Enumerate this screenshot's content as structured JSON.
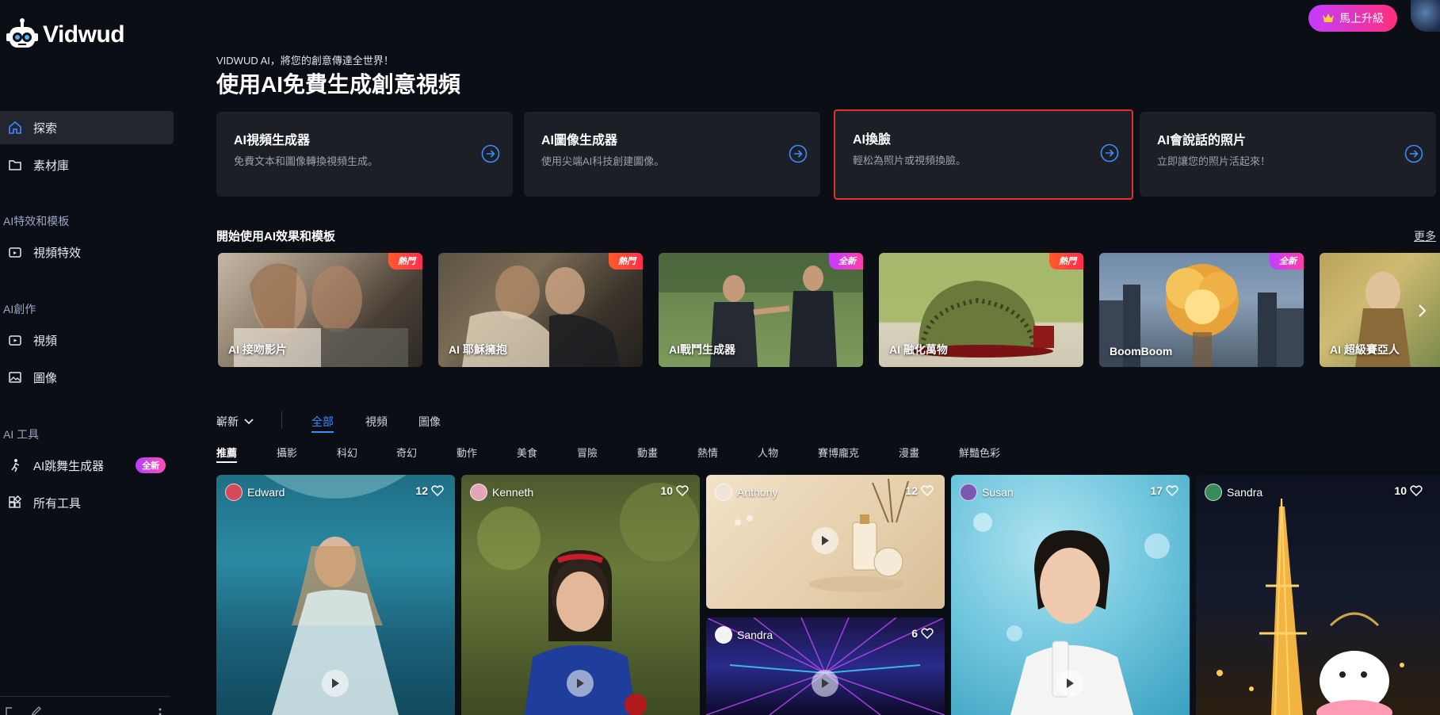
{
  "app": {
    "name": "Vidwud"
  },
  "sidebar": {
    "nav": [
      {
        "label": "探索",
        "icon": "home-icon"
      },
      {
        "label": "素材庫",
        "icon": "folder-icon"
      }
    ],
    "sections": [
      {
        "title": "AI特效和模板",
        "items": [
          {
            "label": "視頻特效",
            "icon": "video-effect-icon"
          }
        ]
      },
      {
        "title": "AI創作",
        "items": [
          {
            "label": "視頻",
            "icon": "video-icon"
          },
          {
            "label": "圖像",
            "icon": "image-icon"
          }
        ]
      },
      {
        "title": "AI 工具",
        "items": [
          {
            "label": "AI跳舞生成器",
            "icon": "dance-icon",
            "badge": "全新"
          },
          {
            "label": "所有工具",
            "icon": "grid-icon"
          }
        ]
      }
    ]
  },
  "topbar": {
    "upgrade_label": "馬上升級"
  },
  "header": {
    "tagline": "VIDWUD AI，將您的創意傳達全世界！",
    "title": "使用AI免費生成創意視頻"
  },
  "tools": [
    {
      "title": "AI視頻生成器",
      "desc": "免費文本和圖像轉換視頻生成。"
    },
    {
      "title": "AI圖像生成器",
      "desc": "使用尖端AI科技創建圖像。"
    },
    {
      "title": "AI換臉",
      "desc": "輕松為照片或視頻換臉。"
    },
    {
      "title": "AI會說話的照片",
      "desc": "立即讓您的照片活起來！"
    }
  ],
  "effects": {
    "title": "開始使用AI效果和模板",
    "more": "更多",
    "items": [
      {
        "label": "AI 接吻影片",
        "tag": "熱門"
      },
      {
        "label": "AI 耶穌擁抱",
        "tag": "熱門"
      },
      {
        "label": "AI戰鬥生成器",
        "tag": "全新"
      },
      {
        "label": "AI 融化萬物",
        "tag": "熱門"
      },
      {
        "label": "BoomBoom",
        "tag": "全新"
      },
      {
        "label": "AI 超級賽亞人",
        "tag": ""
      }
    ]
  },
  "filters": {
    "sort": "嶄新",
    "types": [
      "全部",
      "視頻",
      "圖像"
    ],
    "categories": [
      "推薦",
      "攝影",
      "科幻",
      "奇幻",
      "動作",
      "美食",
      "冒險",
      "動畫",
      "熱情",
      "人物",
      "賽博龐克",
      "漫畫",
      "鮮豔色彩"
    ]
  },
  "gallery": [
    {
      "user": "Edward",
      "likes": "12"
    },
    {
      "user": "Kenneth",
      "likes": "10"
    },
    {
      "user": "Anthony",
      "likes": "12"
    },
    {
      "user": "Sandra",
      "likes": "6"
    },
    {
      "user": "Susan",
      "likes": "17"
    },
    {
      "user": "Sandra",
      "likes": "10"
    }
  ],
  "colors": {
    "accent": "#3d8bff",
    "highlight": "#e0322b",
    "upgrade_start": "#c43cff",
    "upgrade_end": "#ff2f7a"
  }
}
